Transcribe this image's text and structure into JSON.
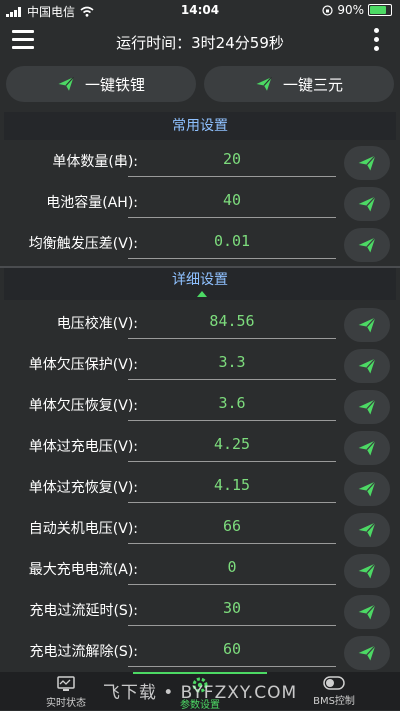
{
  "status_bar": {
    "carrier": "中国电信",
    "time": "14:04",
    "battery": "90%",
    "battery_level": 0.9
  },
  "header": {
    "title": "运行时间：3时24分59秒",
    "menu_icon": "hamburger-icon",
    "more_icon": "more-vertical-icon"
  },
  "quick_actions": [
    {
      "label": "一键铁锂",
      "icon": "send-icon"
    },
    {
      "label": "一键三元",
      "icon": "send-icon"
    }
  ],
  "common_settings": {
    "title": "常用设置",
    "rows": [
      {
        "label": "单体数量(串):",
        "value": "20"
      },
      {
        "label": "电池容量(AH):",
        "value": "40"
      },
      {
        "label": "均衡触发压差(V):",
        "value": "0.01"
      }
    ]
  },
  "detail_settings": {
    "title": "详细设置",
    "rows": [
      {
        "label": "电压校准(V):",
        "value": "84.56"
      },
      {
        "label": "单体欠压保护(V):",
        "value": "3.3"
      },
      {
        "label": "单体欠压恢复(V):",
        "value": "3.6"
      },
      {
        "label": "单体过充电压(V):",
        "value": "4.25"
      },
      {
        "label": "单体过充恢复(V):",
        "value": "4.15"
      },
      {
        "label": "自动关机电压(V):",
        "value": "66"
      },
      {
        "label": "最大充电电流(A):",
        "value": "0"
      },
      {
        "label": "充电过流延时(S):",
        "value": "30"
      },
      {
        "label": "充电过流解除(S):",
        "value": "60"
      }
    ]
  },
  "bottom_nav": [
    {
      "label": "实时状态",
      "icon": "monitor-icon"
    },
    {
      "label": "参数设置",
      "icon": "gear-icon",
      "active": true
    },
    {
      "label": "BMS控制",
      "icon": "toggle-icon"
    }
  ],
  "watermark": "飞下载 • BYFZXY.COM",
  "colors": {
    "accent": "#4cd964",
    "value_text": "#7ddc7d",
    "section_title": "#8fc1ff",
    "background": "#2b2d2e"
  }
}
